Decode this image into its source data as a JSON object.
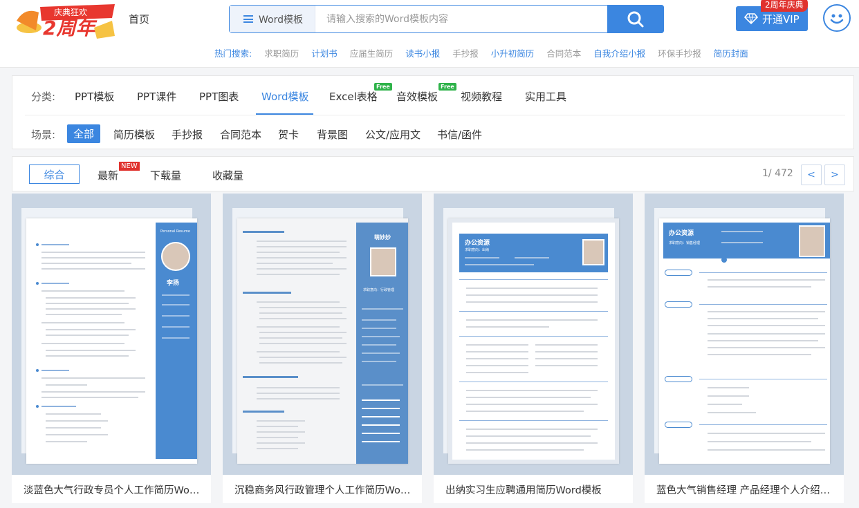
{
  "header": {
    "logo_text": "庆典狂欢 2周年",
    "home": "首页",
    "search_type": "Word模板",
    "search_placeholder": "请输入搜索的Word模板内容",
    "vip_label": "开通VIP",
    "vip_badge": "2周年庆典",
    "hot_label": "热门搜索:",
    "hot_items": [
      {
        "label": "求职简历",
        "style": "gray"
      },
      {
        "label": "计划书",
        "style": "blue"
      },
      {
        "label": "应届生简历",
        "style": "gray"
      },
      {
        "label": "读书小报",
        "style": "blue"
      },
      {
        "label": "手抄报",
        "style": "gray"
      },
      {
        "label": "小升初简历",
        "style": "blue"
      },
      {
        "label": "合同范本",
        "style": "gray"
      },
      {
        "label": "自我介绍小报",
        "style": "blue"
      },
      {
        "label": "环保手抄报",
        "style": "gray"
      },
      {
        "label": "简历封面",
        "style": "blue"
      }
    ]
  },
  "categories": {
    "label": "分类:",
    "items": [
      "PPT模板",
      "PPT课件",
      "PPT图表",
      "Word模板",
      "Excel表格",
      "音效模板",
      "视频教程",
      "实用工具"
    ],
    "active": "Word模板",
    "free_tag": "Free"
  },
  "scenes": {
    "label": "场景:",
    "items": [
      "全部",
      "简历模板",
      "手抄报",
      "合同范本",
      "贺卡",
      "背景图",
      "公文/应用文",
      "书信/函件"
    ],
    "active": "全部"
  },
  "sort": {
    "active": "综合",
    "items": [
      "最新",
      "下载量",
      "收藏量"
    ],
    "new_tag": "NEW",
    "page_info": "1/ 472",
    "prev": "<",
    "next": ">"
  },
  "cards": [
    {
      "title": "淡蓝色大气行政专员个人工作简历Word模板",
      "name": "李扬",
      "sub": "Personal Resume"
    },
    {
      "title": "沉稳商务风行政管理个人工作简历Word模板",
      "name": "萌妙妙",
      "sub": "求职意向：行政管理"
    },
    {
      "title": "出纳实习生应聘通用简历Word模板",
      "name": "办公资源",
      "sub": "求职意向：出纳"
    },
    {
      "title": "蓝色大气销售经理 产品经理个人介绍简历Word模板",
      "name": "办公资源",
      "sub": "求职意向：销售经理"
    }
  ],
  "colors": {
    "accent": "#3b86e0",
    "badge_red": "#e0322e",
    "free_green": "#2fb34a"
  }
}
